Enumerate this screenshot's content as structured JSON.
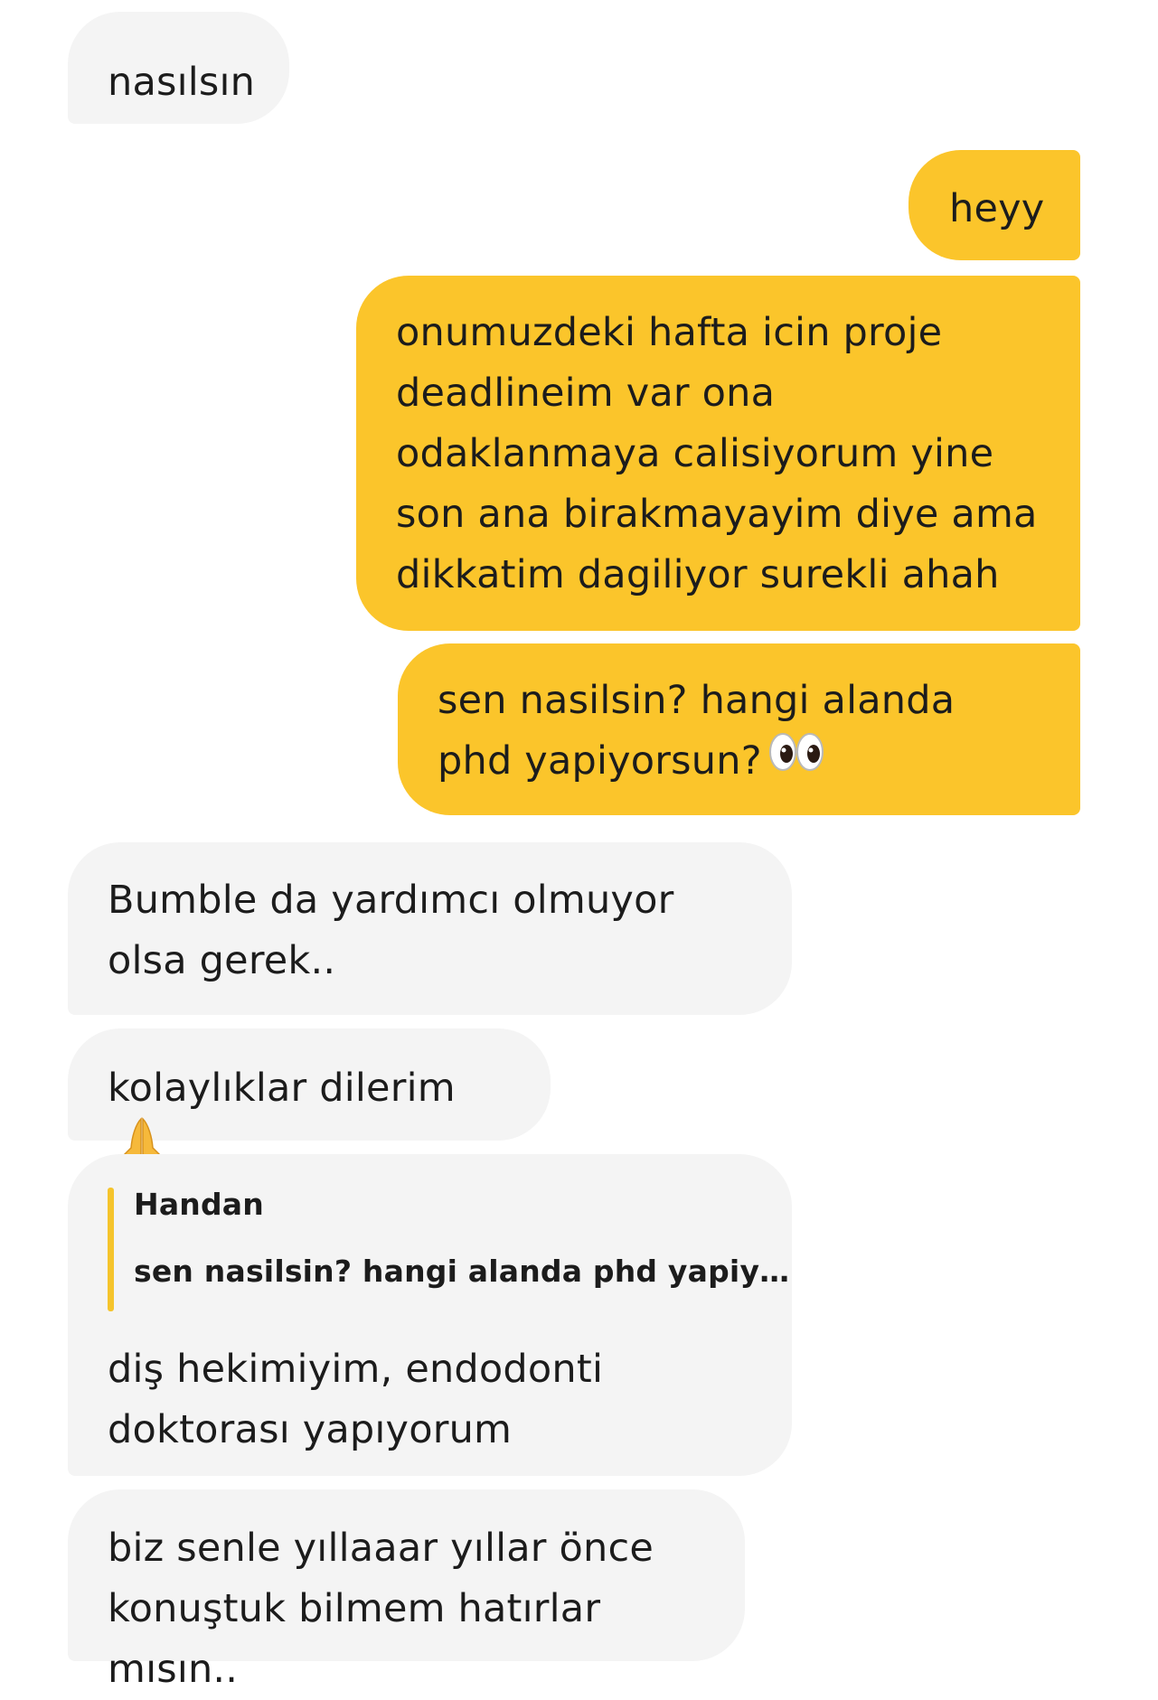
{
  "colors": {
    "incoming_bubble": "#f4f4f4",
    "outgoing_bubble": "#fbc52b",
    "quote_bar": "#f5c42c"
  },
  "messages": [
    {
      "direction": "incoming",
      "text": "nasılsın"
    },
    {
      "direction": "outgoing",
      "text": "heyy"
    },
    {
      "direction": "outgoing",
      "text": "onumuzdeki hafta icin proje deadlineim var ona odaklanmaya calisiyorum yine son ana birakmayayim diye ama dikkatim dagiliyor surekli ahah"
    },
    {
      "direction": "outgoing",
      "text": "sen nasilsin? hangi alanda phd yapiyorsun?",
      "emoji": "eyes-emoji"
    },
    {
      "direction": "incoming",
      "text": "Bumble da yardımcı olmuyor olsa gerek.."
    },
    {
      "direction": "incoming",
      "text": "kolaylıklar dilerim",
      "emoji": "folded-hands-emoji"
    },
    {
      "direction": "incoming",
      "quote": {
        "author": "Handan",
        "text": "sen nasilsin? hangi alanda phd yapiy…"
      },
      "text": "diş hekimiyim, endodonti doktorası yapıyorum"
    },
    {
      "direction": "incoming",
      "text": "biz senle yıllaaar yıllar önce konuştuk bilmem hatırlar mısın.."
    }
  ]
}
